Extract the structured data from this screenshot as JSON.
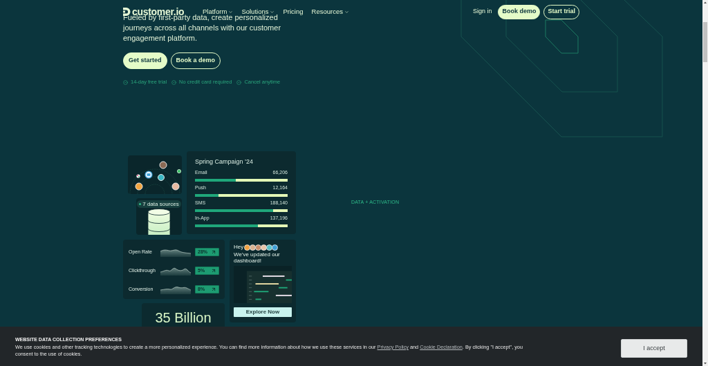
{
  "nav": {
    "logo": "customer.io",
    "links": [
      {
        "label": "Platform",
        "dropdown": true
      },
      {
        "label": "Solutions",
        "dropdown": true
      },
      {
        "label": "Pricing",
        "dropdown": false
      },
      {
        "label": "Resources",
        "dropdown": true
      }
    ],
    "sign_in": "Sign in",
    "buttons": [
      {
        "label": "Book demo",
        "kind": "filled"
      },
      {
        "label": "Start trial",
        "kind": "outline"
      }
    ]
  },
  "hero": {
    "description": "Fueled by first-party data, create personalized journeys across all channels with our customer engagement platform.",
    "buttons": [
      {
        "label": "Get started",
        "kind": "filled"
      },
      {
        "label": "Book a demo",
        "kind": "outline"
      }
    ],
    "perks": [
      "14-day free trial",
      "No credit card required",
      "Cancel anytime"
    ]
  },
  "showcase": {
    "label": "DATA + ACTIVATION",
    "data_sources_badge": "7 data sources",
    "campaign": {
      "title": "Spring Campaign ’24",
      "channels": [
        {
          "name": "Email",
          "count": "66,206",
          "level": 0.44
        },
        {
          "name": "Push",
          "count": "12,164",
          "level": 0.25
        },
        {
          "name": "SMS",
          "count": "188,140",
          "level": 0.84
        },
        {
          "name": "In-App",
          "count": "137,196",
          "level": 0.68
        }
      ]
    },
    "metrics": [
      {
        "name": "Open Rate",
        "value": "28%"
      },
      {
        "name": "Clickthrough",
        "value": "5%"
      },
      {
        "name": "Conversion",
        "value": "8%"
      }
    ],
    "dashboard_card": {
      "greeting": "Hey",
      "message": "We've updated our dashboard!",
      "button": "Explore Now"
    },
    "stats": [
      {
        "value": "35 Billion"
      }
    ]
  },
  "cookie_banner": {
    "title": "WEBSITE DATA COLLECTION PREFERENCES",
    "text": [
      {
        "kind": "text",
        "text": "We use cookies and other tracking technologies to create a more personalized experience. You can find more information about how we use these services in our "
      },
      {
        "kind": "link",
        "text": "Privacy Policy"
      },
      {
        "kind": "text",
        "text": " and "
      },
      {
        "kind": "link",
        "text": "Cookie Declaration"
      },
      {
        "kind": "text",
        "text": ". By clicking \"I accept\", you consent to the use of cookies."
      }
    ],
    "button": "I accept"
  }
}
